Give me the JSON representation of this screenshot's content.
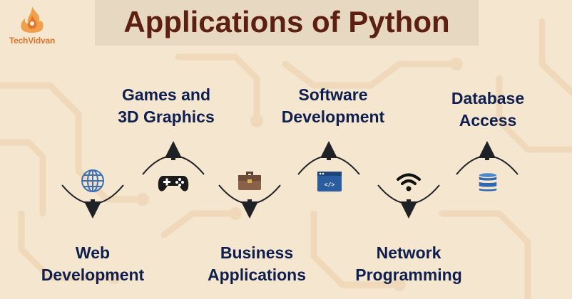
{
  "title": "Applications of Python",
  "logo": {
    "text": "TechVidvan"
  },
  "colors": {
    "title": "#5c1f12",
    "label": "#0e1f4f",
    "arrow": "#1e2227",
    "background": "#f5e6cf",
    "accent": "#e0742b"
  },
  "applications": [
    {
      "line1": "Web",
      "line2": "Development",
      "icon": "globe-icon",
      "direction": "down"
    },
    {
      "line1": "Games and",
      "line2": "3D Graphics",
      "icon": "gamepad-icon",
      "direction": "up"
    },
    {
      "line1": "Business",
      "line2": "Applications",
      "icon": "briefcase-icon",
      "direction": "down"
    },
    {
      "line1": "Software",
      "line2": "Development",
      "icon": "code-icon",
      "direction": "up"
    },
    {
      "line1": "Network",
      "line2": "Programming",
      "icon": "wifi-icon",
      "direction": "down"
    },
    {
      "line1": "Database",
      "line2": "Access",
      "icon": "database-icon",
      "direction": "up"
    }
  ]
}
